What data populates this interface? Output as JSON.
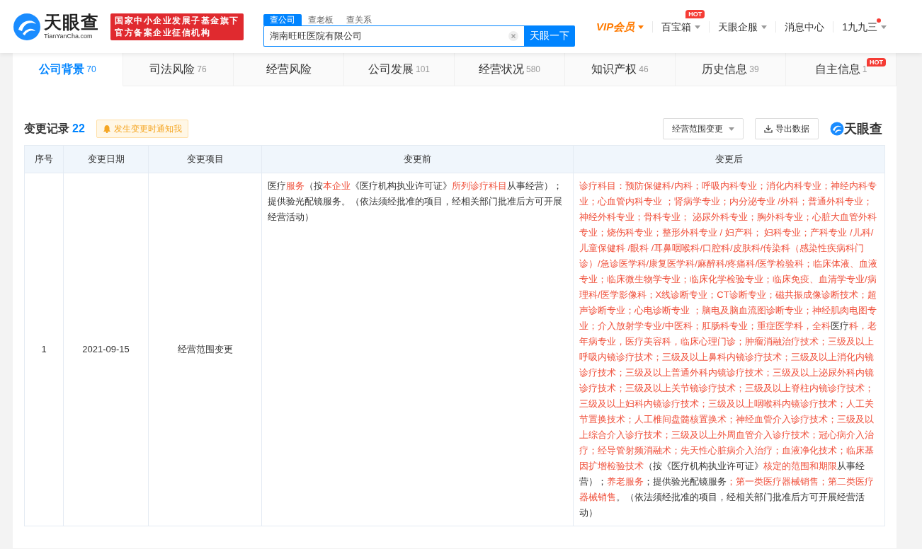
{
  "header": {
    "logo": {
      "name": "天眼查",
      "domain": "TianYanCha.com"
    },
    "slogan": [
      "国家中小企业发展子基金旗下",
      "官方备案企业征信机构"
    ],
    "search": {
      "tabs": [
        {
          "label": "查公司",
          "selected": true
        },
        {
          "label": "查老板",
          "selected": false
        },
        {
          "label": "查关系",
          "selected": false
        }
      ],
      "value": "湖南旺旺医院有限公司",
      "button": "天眼一下"
    },
    "nav": [
      {
        "label": "VIP会员",
        "kind": "vip",
        "caret": true
      },
      {
        "label": "百宝箱",
        "kind": "menu",
        "caret": true,
        "badge": "HOT"
      },
      {
        "label": "天眼企服",
        "kind": "menu",
        "caret": true
      },
      {
        "label": "消息中心",
        "kind": "menu",
        "caret": false
      },
      {
        "label": "1九九三",
        "kind": "user",
        "caret": true
      }
    ]
  },
  "tabs": [
    {
      "label": "公司背景",
      "count": "70",
      "selected": true
    },
    {
      "label": "司法风险",
      "count": "76",
      "selected": false
    },
    {
      "label": "经营风险",
      "selected": false
    },
    {
      "label": "公司发展",
      "count": "101",
      "selected": false
    },
    {
      "label": "经营状况",
      "count": "580",
      "selected": false
    },
    {
      "label": "知识产权",
      "count": "46",
      "selected": false
    },
    {
      "label": "历史信息",
      "count": "39",
      "selected": false
    },
    {
      "label": "自主信息",
      "count": "1",
      "selected": false,
      "badge": "HOT"
    }
  ],
  "section": {
    "title": "变更记录",
    "count": "22",
    "notify": "发生变更时通知我",
    "filter": "经营范围变更",
    "export": "导出数据",
    "brand": "天眼查"
  },
  "table": {
    "columns": [
      "序号",
      "变更日期",
      "变更项目",
      "变更前",
      "变更后"
    ],
    "rows": [
      {
        "index": "1",
        "date": "2021-09-15",
        "item": "经营范围变更",
        "before": [
          {
            "text": "医疗",
            "changed": false
          },
          {
            "text": "服务",
            "changed": true
          },
          {
            "text": "（按",
            "changed": false
          },
          {
            "text": "本企业",
            "changed": true
          },
          {
            "text": "《医疗机构执业许可证》",
            "changed": false
          },
          {
            "text": "所列诊疗科目",
            "changed": true
          },
          {
            "text": "从事经营）；提供验光配镜服务。（依法须经批准的项目，经相关部门批准后方可开展经营活动）",
            "changed": false
          }
        ],
        "after": [
          {
            "text": "诊疗科目：预防保健科/内科；呼吸内科专业；消化内科专业；神经内科专业；心血管内科专业 ；肾病学专业；内分泌专业 /外科；普通外科专业；神经外科专业；骨科专业； 泌尿外科专业；胸外科专业；心脏大血管外科专业；烧伤科专业；整形外科专业 / 妇产科； 妇科专业；产科专业 /儿科/儿童保健科 /眼科 /耳鼻咽喉科/口腔科/皮肤科/传染科（感染性疾病科门诊）/急诊医学科/康复医学科/麻醉科/疼痛科/医学检验科；临床体液、血液专业；临床微生物学专业；临床化学检验专业；临床免疫、血清学专业/病理科/医学影像科；X线诊断专业；CT诊断专业；磁共振成像诊断技术；超声诊断专业；心电诊断专业 ；脑电及脑血流图诊断专业；神经肌肉电图专业；介入放射学专业/中医科；肛肠科专业；重症医学科，全科",
            "changed": true
          },
          {
            "text": "医疗",
            "changed": false
          },
          {
            "text": "科，老年病专业，医疗美容科，临床心理门诊；肿瘤消融治疗技术；三级及以上呼吸内镜诊疗技术；三级及以上鼻科内镜诊疗技术；三级及以上消化内镜诊疗技术；三级及以上普通外科内镜诊疗技术；三级及以上泌尿外科内镜诊疗技术；三级及以上关节镜诊疗技术；三级及以上脊柱内镜诊疗技术；三级及以上妇科内镜诊疗技术；三级及以上咽喉科内镜诊疗技术；人工关节置换技术；人工椎间盘髓核置换术；神经血管介入诊疗技术；三级及以上综合介入诊疗技术；三级及以上外周血管介入诊疗技术；冠心病介入治疗；经导管射频消融术；先天性心脏病介入治疗；血液净化技术；临床基因扩增检验技术",
            "changed": true
          },
          {
            "text": "（按《医疗机构执业许可证》",
            "changed": false
          },
          {
            "text": "核定的范围和期限",
            "changed": true
          },
          {
            "text": "从事经营）；",
            "changed": false
          },
          {
            "text": "养老服务",
            "changed": true
          },
          {
            "text": "；提供验光配镜服务",
            "changed": false
          },
          {
            "text": "；第一类医疗器械销售；第二类医疗器械销售",
            "changed": true
          },
          {
            "text": "。（依法须经批准的项目，经相关部门批准后方可开展经营活动）",
            "changed": false
          }
        ]
      }
    ]
  }
}
